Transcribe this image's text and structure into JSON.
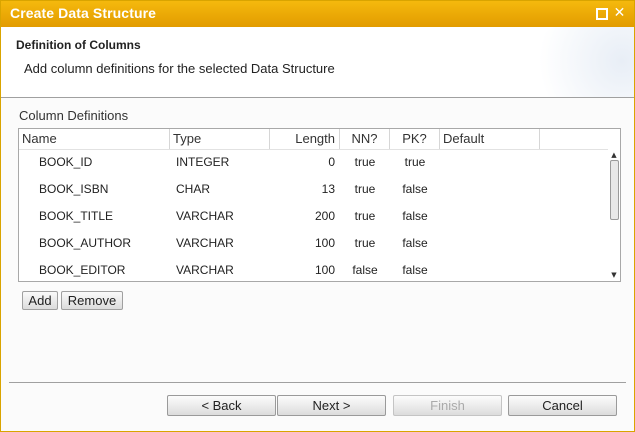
{
  "window": {
    "title": "Create Data Structure"
  },
  "header": {
    "title": "Definition of Columns",
    "description": "Add column definitions for the selected Data Structure"
  },
  "group": {
    "label": "Column Definitions"
  },
  "table": {
    "columns": [
      "Name",
      "Type",
      "Length",
      "NN?",
      "PK?",
      "Default"
    ],
    "rows": [
      {
        "name": "BOOK_ID",
        "type": "INTEGER",
        "length": "0",
        "nn": "true",
        "pk": "true",
        "default": ""
      },
      {
        "name": "BOOK_ISBN",
        "type": "CHAR",
        "length": "13",
        "nn": "true",
        "pk": "false",
        "default": ""
      },
      {
        "name": "BOOK_TITLE",
        "type": "VARCHAR",
        "length": "200",
        "nn": "true",
        "pk": "false",
        "default": ""
      },
      {
        "name": "BOOK_AUTHOR",
        "type": "VARCHAR",
        "length": "100",
        "nn": "true",
        "pk": "false",
        "default": ""
      },
      {
        "name": "BOOK_EDITOR",
        "type": "VARCHAR",
        "length": "100",
        "nn": "false",
        "pk": "false",
        "default": ""
      }
    ]
  },
  "actions": {
    "add": "Add",
    "remove": "Remove"
  },
  "footer": {
    "back": "< Back",
    "next": "Next >",
    "finish": "Finish",
    "cancel": "Cancel"
  },
  "icons": {
    "maximize": "maximize-icon",
    "close": "close-icon",
    "scroll_up": "arrow-up-icon",
    "scroll_down": "arrow-down-icon"
  },
  "colors": {
    "titlebar": "#f0ad00",
    "border": "#d9a400"
  }
}
